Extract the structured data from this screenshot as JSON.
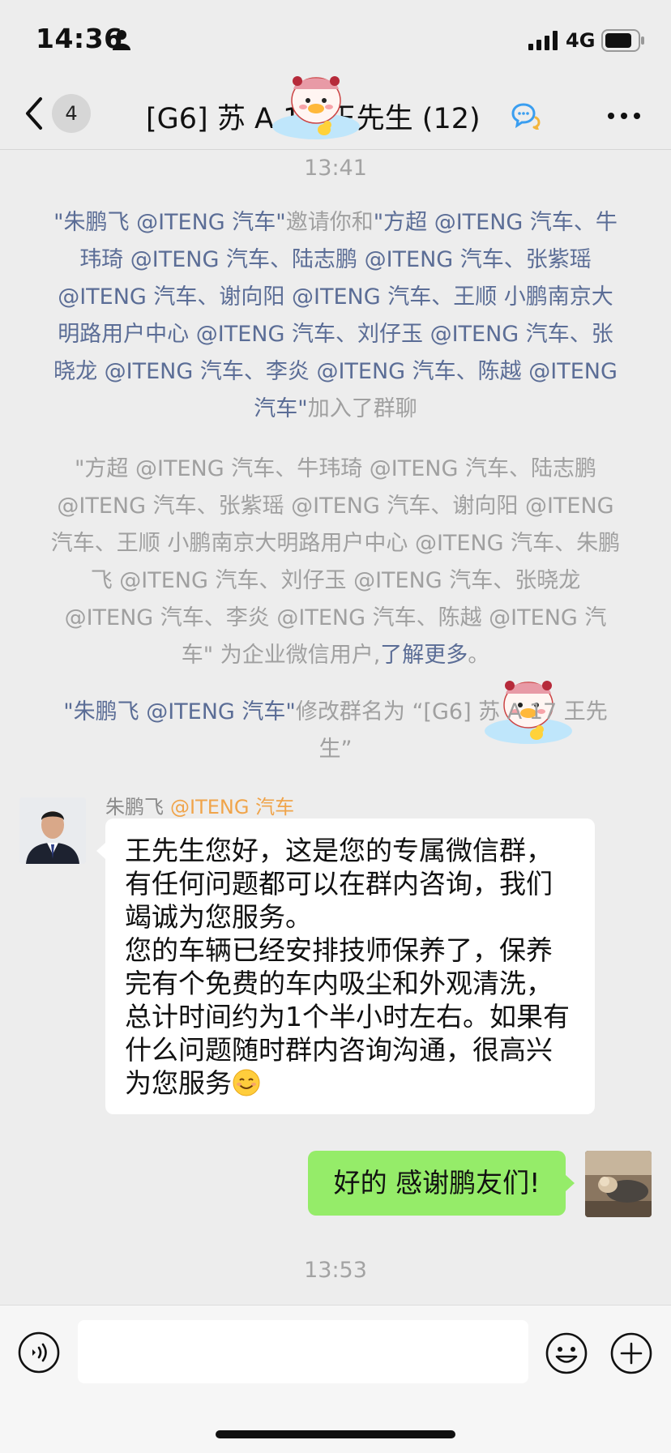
{
  "status_bar": {
    "time": "14:36",
    "network": "4G"
  },
  "nav": {
    "unread_count": "4",
    "title": "[G6] 苏 A     17 王先生 (12)"
  },
  "messages": {
    "time1": "13:41",
    "sys1": {
      "inviter": "\"朱鹏飞 @ITENG 汽车\"",
      "mid": "邀请你和",
      "invitees": "\"方超 @ITENG 汽车、牛玮琦 @ITENG 汽车、陆志鹏 @ITENG 汽车、张紫瑶 @ITENG 汽车、谢向阳 @ITENG 汽车、王顺 小鹏南京大明路用户中心 @ITENG 汽车、刘仔玉 @ITENG 汽车、张晓龙 @ITENG 汽车、李炎 @ITENG 汽车、陈越 @ITENG 汽车\"",
      "tail": "加入了群聊"
    },
    "sys2": {
      "text": "\"方超 @ITENG 汽车、牛玮琦 @ITENG 汽车、陆志鹏 @ITENG 汽车、张紫瑶 @ITENG 汽车、谢向阳 @ITENG 汽车、王顺 小鹏南京大明路用户中心 @ITENG 汽车、朱鹏飞 @ITENG 汽车、刘仔玉 @ITENG 汽车、张晓龙 @ITENG 汽车、李炎 @ITENG 汽车、陈越 @ITENG 汽车\" 为企业微信用户,",
      "link": "了解更多",
      "end": "。"
    },
    "sys3": {
      "actor": "\"朱鹏飞 @ITENG 汽车\"",
      "text": "修改群名为 “[G6] 苏 A     17 王先生”"
    },
    "incoming": {
      "sender": "朱鹏飞",
      "org": "@ITENG 汽车",
      "text": "王先生您好，这是您的专属微信群，有任何问题都可以在群内咨询，我们竭诚为您服务。\n您的车辆已经安排技师保养了，保养完有个免费的车内吸尘和外观清洗，总计时间约为1个半小时左右。如果有什么问题随时群内咨询沟通，很高兴为您服务"
    },
    "outgoing": {
      "text": "好的 感谢鹏友们!"
    },
    "time2": "13:53"
  },
  "input": {
    "placeholder": ""
  },
  "icons": {
    "back": "chevron-left-icon",
    "more": "more-dots-icon",
    "voice": "voice-icon",
    "emoji": "emoji-icon",
    "plus": "plus-circle-icon",
    "group": "group-chat-icon"
  },
  "colors": {
    "background": "#ededed",
    "outgoing_bubble": "#95ec69",
    "incoming_bubble": "#ffffff",
    "name_link": "#5b6d96",
    "org_orange": "#f0a44a"
  }
}
